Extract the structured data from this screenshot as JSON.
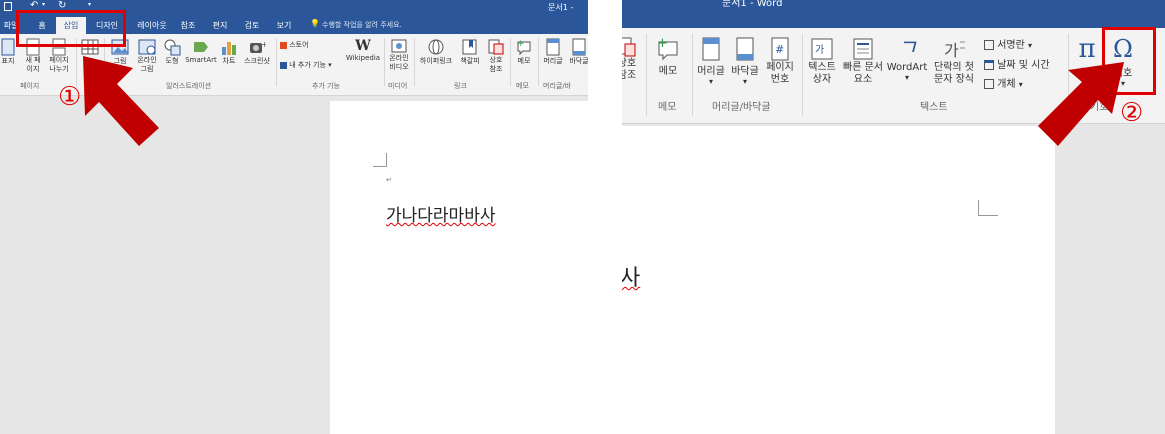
{
  "left": {
    "title": "문서1 - Wo",
    "tabs": [
      "파일",
      "홈",
      "삽입",
      "디자인",
      "레이아웃",
      "참조",
      "편지",
      "검토",
      "보기"
    ],
    "tell_me": "수행할 작업을 알려 주세요.",
    "buttons": {
      "cover": "표지",
      "new_page": [
        "새 페",
        "이지"
      ],
      "page_break": [
        "페이지",
        "나누기"
      ],
      "table": "표",
      "picture": "그림",
      "online_picture": [
        "온라인",
        "그림"
      ],
      "shapes": "도형",
      "smartart": "SmartArt",
      "chart": "차트",
      "screenshot": "스크린샷",
      "store": "스토어",
      "my_addins": "내 추가 기능",
      "wikipedia": "Wikipedia",
      "online_video": [
        "온라인",
        "비디오"
      ],
      "hyperlink": "하이퍼링크",
      "bookmark": "책갈피",
      "cross_ref": [
        "상호",
        "참조"
      ],
      "comment": "메모",
      "header": "머리글",
      "footer": "바닥글"
    },
    "groups": [
      "페이지",
      "표",
      "일러스트레이션",
      "추가 기능",
      "미디어",
      "링크",
      "메모",
      "머리글/바"
    ],
    "doc_text": "가나다라마바사",
    "callout_number": "①"
  },
  "right": {
    "title": "문서1 - Word",
    "buttons": {
      "cross_ref": [
        "상호",
        "참조"
      ],
      "comment": "메모",
      "header": "머리글",
      "footer": "바닥글",
      "page_number": [
        "페이지",
        "번호"
      ],
      "text_box": [
        "텍스트",
        "상자"
      ],
      "quick_parts": [
        "빠른 문서",
        "요소"
      ],
      "wordart": "WordArt",
      "drop_cap": [
        "단락의 첫",
        "문자 장식"
      ],
      "signature": "서명란",
      "date_time": "날짜 및 시간",
      "object": "개체",
      "equation": "수식",
      "symbol": "기호"
    },
    "groups": [
      "메모",
      "머리글/바닥글",
      "텍스트",
      "기호"
    ],
    "doc_text": "사",
    "callout_number": "②"
  },
  "colors": {
    "accent": "#2b579a",
    "callout": "#e00000",
    "arrow": "#c00000"
  }
}
